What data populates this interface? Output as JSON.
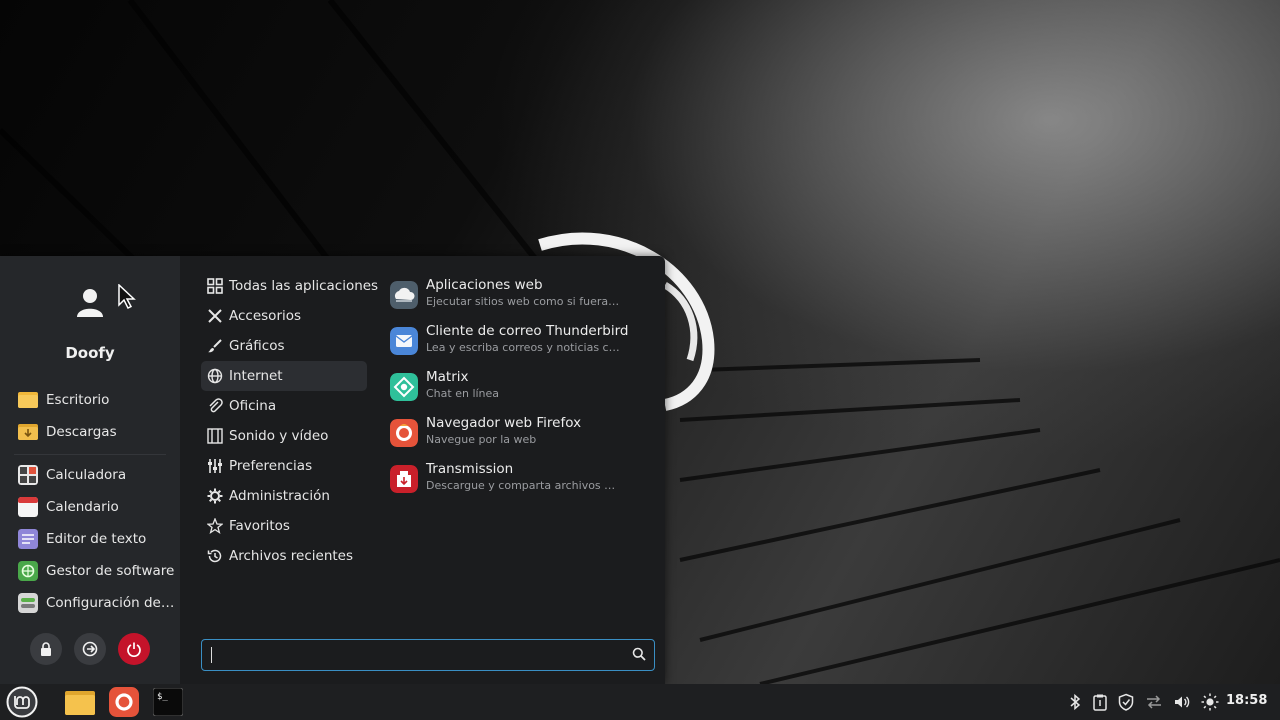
{
  "user": {
    "name": "Doofy"
  },
  "favorites": {
    "places": [
      {
        "label": "Escritorio",
        "icon": "folder-icon"
      },
      {
        "label": "Descargas",
        "icon": "downloads-folder-icon"
      }
    ],
    "apps": [
      {
        "label": "Calculadora",
        "icon": "calculator-icon"
      },
      {
        "label": "Calendario",
        "icon": "calendar-icon"
      },
      {
        "label": "Editor de texto",
        "icon": "text-editor-icon"
      },
      {
        "label": "Gestor de software",
        "icon": "software-manager-icon"
      },
      {
        "label": "Configuración de…",
        "icon": "settings-icon"
      }
    ]
  },
  "session_buttons": [
    "lock-icon",
    "logout-icon",
    "power-icon"
  ],
  "categories": [
    {
      "label": "Todas las aplicaciones",
      "icon": "grid-icon"
    },
    {
      "label": "Accesorios",
      "icon": "tools-icon"
    },
    {
      "label": "Gráficos",
      "icon": "brush-icon"
    },
    {
      "label": "Internet",
      "icon": "globe-icon",
      "active": true
    },
    {
      "label": "Oficina",
      "icon": "paperclip-icon"
    },
    {
      "label": "Sonido y vídeo",
      "icon": "media-icon"
    },
    {
      "label": "Preferencias",
      "icon": "sliders-icon"
    },
    {
      "label": "Administración",
      "icon": "gear-icon"
    },
    {
      "label": "Favoritos",
      "icon": "star-icon"
    },
    {
      "label": "Archivos recientes",
      "icon": "history-icon"
    }
  ],
  "apps": [
    {
      "name": "Aplicaciones web",
      "desc": "Ejecutar sitios web como si fueran aplicaciones",
      "icon": "web-apps-icon",
      "color": "#5a6b78"
    },
    {
      "name": "Cliente de correo Thunderbird",
      "desc": "Lea y escriba correos y noticias con Thunderbird",
      "icon": "mail-icon",
      "color": "#4a86d8"
    },
    {
      "name": "Matrix",
      "desc": "Chat en línea",
      "icon": "matrix-icon",
      "color": "#2fc09a"
    },
    {
      "name": "Navegador web Firefox",
      "desc": "Navegue por la web",
      "icon": "firefox-icon",
      "color": "#e5533a"
    },
    {
      "name": "Transmission",
      "desc": "Descargue y comparta archivos mediante BitTorrent",
      "icon": "transmission-icon",
      "color": "#c9202a"
    }
  ],
  "search": {
    "value": "",
    "placeholder": ""
  },
  "taskbar": {
    "launchers": [
      "mint-menu-icon",
      "files-icon",
      "firefox-icon",
      "terminal-icon"
    ],
    "tray": [
      "bluetooth-icon",
      "clipboard-icon",
      "shield-icon",
      "network-icon",
      "volume-icon",
      "brightness-icon"
    ],
    "clock": "18:58"
  },
  "colors": {
    "accent": "#3a8fc4",
    "power": "#c4132a"
  }
}
